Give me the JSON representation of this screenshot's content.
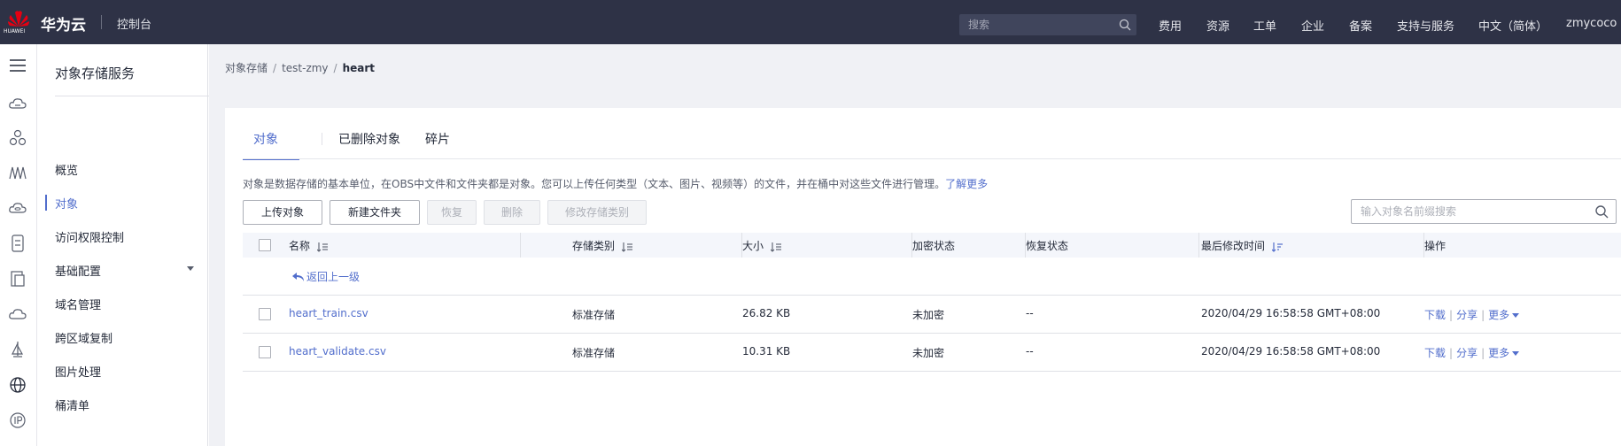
{
  "topbar": {
    "logo_text": "HUAWEI",
    "brand": "华为云",
    "console": "控制台",
    "search_placeholder": "搜索",
    "nav": [
      "费用",
      "资源",
      "工单",
      "企业",
      "备案",
      "支持与服务",
      "中文（简体）",
      "zmycoco"
    ]
  },
  "rail": {
    "icons": [
      "menu-icon",
      "cloud-server-icon",
      "cluster-icon",
      "network-icon",
      "cloud-db-icon",
      "storage-icon",
      "document-icon",
      "cloud-icon",
      "deploy-icon",
      "globe-icon",
      "ip-icon"
    ]
  },
  "sidebar": {
    "title": "对象存储服务",
    "items": [
      {
        "label": "概览",
        "active": false
      },
      {
        "label": "对象",
        "active": true
      },
      {
        "label": "访问权限控制",
        "active": false
      },
      {
        "label": "基础配置",
        "active": false,
        "expandable": true
      },
      {
        "label": "域名管理",
        "active": false
      },
      {
        "label": "跨区域复制",
        "active": false
      },
      {
        "label": "图片处理",
        "active": false
      },
      {
        "label": "桶清单",
        "active": false
      }
    ]
  },
  "breadcrumb": [
    "对象存储",
    "test-zmy",
    "heart"
  ],
  "tabs": [
    {
      "label": "对象",
      "active": true
    },
    {
      "label": "已删除对象",
      "active": false
    },
    {
      "label": "碎片",
      "active": false
    }
  ],
  "description": {
    "text": "对象是数据存储的基本单位，在OBS中文件和文件夹都是对象。您可以上传任何类型（文本、图片、视频等）的文件，并在桶中对这些文件进行管理。",
    "link": "了解更多"
  },
  "toolbar": {
    "upload": "上传对象",
    "new_folder": "新建文件夹",
    "restore": "恢复",
    "delete": "删除",
    "change_class": "修改存储类别",
    "search_placeholder": "输入对象名前缀搜索"
  },
  "table": {
    "columns": [
      "名称",
      "存储类别",
      "大小",
      "加密状态",
      "恢复状态",
      "最后修改时间",
      "操作"
    ],
    "back_label": "返回上一级",
    "rows": [
      {
        "name": "heart_train.csv",
        "storage_class": "标准存储",
        "size": "26.82 KB",
        "encryption": "未加密",
        "restore": "--",
        "modified": "2020/04/29 16:58:58 GMT+08:00"
      },
      {
        "name": "heart_validate.csv",
        "storage_class": "标准存储",
        "size": "10.31 KB",
        "encryption": "未加密",
        "restore": "--",
        "modified": "2020/04/29 16:58:58 GMT+08:00"
      }
    ],
    "ops": [
      "下载",
      "分享",
      "更多"
    ]
  },
  "colors": {
    "topbar_bg": "#2e3246",
    "accent": "#526ecc",
    "logo_red": "#e60012",
    "page_bg": "#f0f1f5"
  }
}
